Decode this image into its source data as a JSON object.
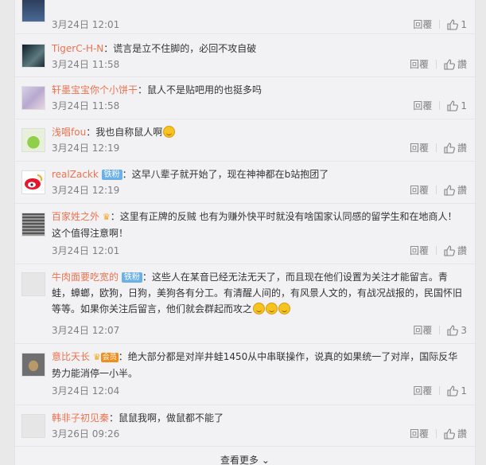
{
  "comments": [
    {
      "name": "",
      "text": "",
      "time": "3月24日 12:01",
      "reply": "回覆",
      "likes": "1"
    },
    {
      "name": "TigerC-H-N",
      "text": "：谎言是立不住脚的，必回不攻自破",
      "time": "3月24日 11:58",
      "reply": "回覆",
      "likes": "讚"
    },
    {
      "name": "轩墨宝宝你个小饼干",
      "text": "：鼠人不是贴吧用的也挺多吗",
      "time": "3月24日 11:58",
      "reply": "回覆",
      "likes": "1"
    },
    {
      "name": "浅唱fou",
      "text": "：我也自称鼠人啊",
      "time": "3月24日 12:19",
      "reply": "回覆",
      "likes": "讚"
    },
    {
      "name": "realZackk",
      "badge": "铁粉",
      "text": "：这早八辈子就开始了，现在神神都在b站抱团了",
      "time": "3月24日 12:19",
      "reply": "回覆",
      "likes": "讚"
    },
    {
      "name": "百家姓之外",
      "text": "：这里有正牌的反贼 也有为赚外快平时就没有啥国家认同感的留学生和在地商人！",
      "text2": "这个值得注意啊！",
      "time": "3月24日 12:01",
      "reply": "回覆",
      "likes": "讚"
    },
    {
      "name": "牛肉面要吃宽的",
      "badge": "铁粉",
      "text": "：这些人在某音已经无法无天了，而且现在他们设置为关注才能留言。青",
      "text2": "蛙，蟑螂，欧狗，日狗，美狗各有分工。有清醒人间的，有风景人文的，有战况战报的，民国怀旧",
      "text3": "等等。如果你关注后留言，他们就会群起而攻之",
      "time": "3月24日 12:07",
      "reply": "回覆",
      "likes": "3"
    },
    {
      "name": "意比天长",
      "vip": "会员",
      "text": "：绝大部分都是对岸井蛙1450从中串联操作，说真的如果统一了对岸，国际反华",
      "text2": "势力能消停一小半。",
      "time": "3月24日 12:04",
      "reply": "回覆",
      "likes": "1"
    },
    {
      "name": "韩非子初见秦",
      "text": "：鼠鼠我啊，做鼠都不能了",
      "time": "3月26日 09:26",
      "reply": "回覆",
      "likes": "讚"
    }
  ],
  "more_label": "查看更多"
}
